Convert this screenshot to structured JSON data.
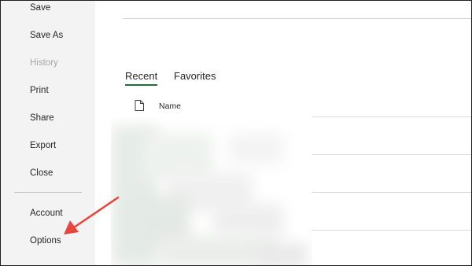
{
  "sidebar": {
    "items": [
      {
        "label": "Save"
      },
      {
        "label": "Save As"
      },
      {
        "label": "History"
      },
      {
        "label": "Print"
      },
      {
        "label": "Share"
      },
      {
        "label": "Export"
      },
      {
        "label": "Close"
      },
      {
        "label": "Account"
      },
      {
        "label": "Options"
      }
    ]
  },
  "main": {
    "tabs": [
      {
        "label": "Recent",
        "active": true
      },
      {
        "label": "Favorites",
        "active": false
      }
    ],
    "list": {
      "column_name": "Name"
    }
  },
  "annotation": {
    "arrow_color": "#e8453c",
    "arrow_icon": "arrow-pointer-icon"
  },
  "colors": {
    "sidebar_bg": "#f3f3f3",
    "tab_underline": "#1e6e3e",
    "disabled_text": "#a6a6a6"
  }
}
